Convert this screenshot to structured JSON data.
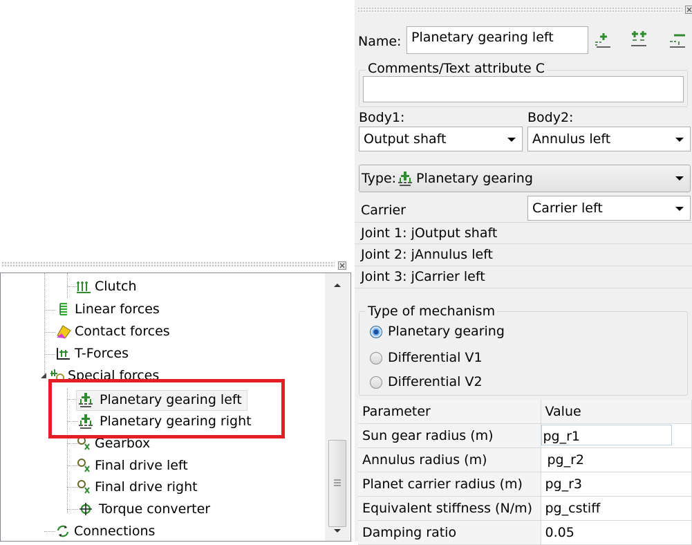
{
  "properties": {
    "name_label": "Name:",
    "name_value": "Planetary gearing left",
    "comments_label": "Comments/Text attribute C",
    "comments_value": "",
    "body1_label": "Body1:",
    "body2_label": "Body2:",
    "body1_value": "Output shaft",
    "body2_value": "Annulus left",
    "type_label": "Type:",
    "type_value": "Planetary gearing",
    "carrier_label": "Carrier",
    "carrier_value": "Carrier left",
    "joints": [
      "Joint 1: jOutput shaft",
      "Joint 2: jAnnulus left",
      "Joint 3: jCarrier left"
    ],
    "mechanism_title": "Type of mechanism",
    "mechanism_options": [
      "Planetary gearing",
      "Differential V1",
      "Differential V2"
    ],
    "mechanism_selected": "Planetary gearing",
    "param_headers": [
      "Parameter",
      "Value"
    ],
    "params": [
      {
        "name": "Sun gear radius (m)",
        "value": "pg_r1"
      },
      {
        "name": "Annulus radius (m)",
        "value": "pg_r2"
      },
      {
        "name": "Planet carrier radius (m)",
        "value": "pg_r3"
      },
      {
        "name": "Equivalent stiffness (N/m)",
        "value": "pg_cstiff"
      },
      {
        "name": "Damping ratio",
        "value": "0.05"
      }
    ]
  },
  "tree": {
    "items": [
      {
        "label": "Clutch",
        "icon": "clutch-icon"
      },
      {
        "label": "Linear forces",
        "icon": "spring-icon"
      },
      {
        "label": "Contact forces",
        "icon": "contact-icon"
      },
      {
        "label": "T-Forces",
        "icon": "t-force-icon"
      },
      {
        "label": "Special forces",
        "icon": "special-forces-icon"
      },
      {
        "label": "Planetary gearing left",
        "icon": "planetary-gear-icon"
      },
      {
        "label": "Planetary gearing right",
        "icon": "planetary-gear-icon"
      },
      {
        "label": "Gearbox",
        "icon": "gearbox-icon"
      },
      {
        "label": "Final drive left",
        "icon": "final-drive-icon"
      },
      {
        "label": "Final drive right",
        "icon": "final-drive-icon"
      },
      {
        "label": "Torque converter",
        "icon": "torque-converter-icon"
      },
      {
        "label": "Connections",
        "icon": "connections-icon"
      }
    ],
    "selected": "Planetary gearing left"
  },
  "colors": {
    "highlight": "#e31e24",
    "gear_green": "#2e8b2e",
    "radio_selected": "#1a4e9c"
  }
}
